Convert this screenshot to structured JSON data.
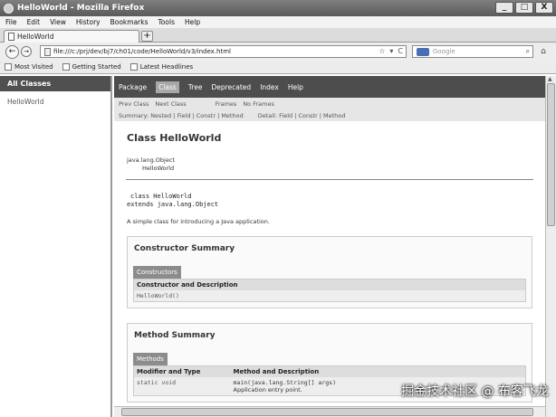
{
  "window": {
    "title": "HelloWorld - Mozilla Firefox",
    "min": "_",
    "max": "□",
    "close": "X"
  },
  "menu": [
    "File",
    "Edit",
    "View",
    "History",
    "Bookmarks",
    "Tools",
    "Help"
  ],
  "tab": {
    "title": "HelloWorld",
    "new_tab": "+"
  },
  "nav": {
    "back": "←",
    "forward": "→",
    "url": "file:///c:/prj/dev/bj7/ch01/code/HelloWorld/v3/index.html",
    "star": "☆",
    "dropdown": "▾",
    "reload": "C",
    "search_placeholder": "Google",
    "search_icon": "⌕",
    "home": "⌂"
  },
  "bookmarks": [
    "Most Visited",
    "Getting Started",
    "Latest Headlines"
  ],
  "left_frame": {
    "header": "All Classes",
    "classes": [
      "HelloWorld"
    ]
  },
  "javadoc": {
    "top_nav": [
      "Package",
      "Class",
      "Tree",
      "Deprecated",
      "Index",
      "Help"
    ],
    "selected_nav": "Class",
    "sub_nav": {
      "prev": "Prev Class",
      "next": "Next Class",
      "frames": "Frames",
      "noframes": "No Frames",
      "summary": "Summary: Nested | Field | Constr | Method",
      "detail": "Detail: Field | Constr | Method"
    },
    "title": "Class HelloWorld",
    "inheritance": {
      "parent": "java.lang.Object",
      "child": "HelloWorld"
    },
    "signature": {
      "line1": "class HelloWorld",
      "line2": "extends java.lang.Object"
    },
    "description": "A simple class for introducing a Java application.",
    "constructor_summary": {
      "heading": "Constructor Summary",
      "caption": "Constructors",
      "header": "Constructor and Description",
      "rows": [
        "HelloWorld()"
      ]
    },
    "method_summary": {
      "heading": "Method Summary",
      "caption": "Methods",
      "headers": [
        "Modifier and Type",
        "Method and Description"
      ],
      "rows": [
        {
          "type": "static void",
          "method": "main(java.lang.String[] args)",
          "desc": "Application entry point."
        }
      ]
    }
  },
  "watermark": "掘金技术社区 @ 布客飞龙"
}
